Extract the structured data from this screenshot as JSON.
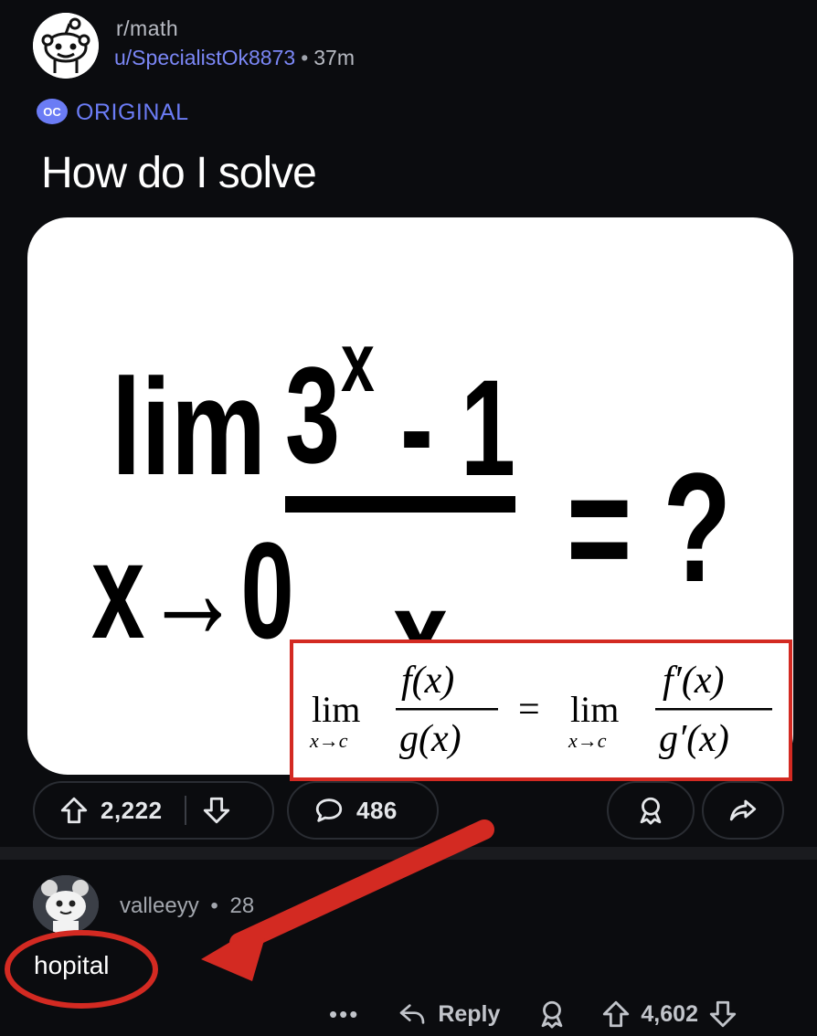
{
  "post": {
    "subreddit": "r/math",
    "username": "u/SpecialistOk8873",
    "separator": "•",
    "time": "37m",
    "badge_icon_text": "OC",
    "badge_label": "ORIGINAL",
    "title": "How do I solve",
    "image": {
      "limit_word": "lim",
      "limit_sub": "x→0",
      "numerator": "3",
      "exponent": "x",
      "minus_one": "- 1",
      "denominator": "x",
      "equals_question": "= ?",
      "overlay_formula": {
        "lhs_lim": "lim",
        "lhs_sub": "x→c",
        "lhs_num": "f(x)",
        "lhs_den": "g(x)",
        "equals": "=",
        "rhs_lim": "lim",
        "rhs_sub": "x→c",
        "rhs_num": "f′(x)",
        "rhs_den": "g′(x)"
      }
    },
    "actions": {
      "upvotes": "2,222",
      "comments": "486"
    }
  },
  "comment": {
    "username": "valleeyy",
    "separator": "•",
    "time": "28",
    "text": "hopital",
    "more_label": "•••",
    "reply_label": "Reply",
    "votes": "4,602"
  },
  "colors": {
    "background": "#0b0c0f",
    "accent_blue": "#6b7cf5",
    "annotation_red": "#d32a22"
  },
  "icons": [
    "reddit-snoo-icon",
    "oc-icon",
    "upvote-icon",
    "downvote-icon",
    "comment-icon",
    "award-icon",
    "share-icon",
    "reply-icon"
  ]
}
